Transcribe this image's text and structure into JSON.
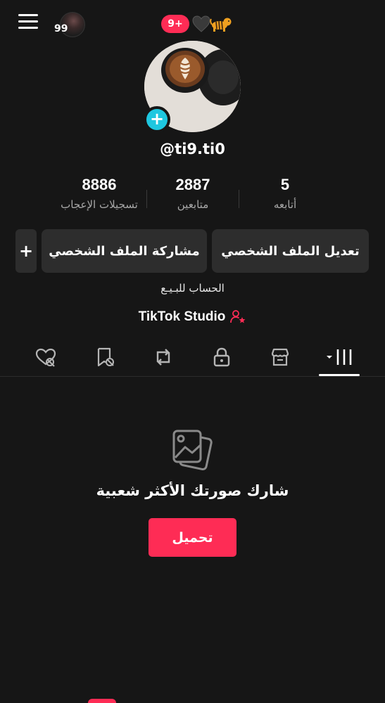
{
  "header": {
    "views_count": "99",
    "notifications_badge": "9+",
    "title_emojis": [
      "black-heart",
      "tiger"
    ]
  },
  "profile": {
    "username": "@ti9.ti0",
    "bio": "الحساب للبـيـع",
    "studio_link": "TikTok Studio"
  },
  "stats": [
    {
      "value": "8886",
      "label": "تسجيلات الإعجاب"
    },
    {
      "value": "2887",
      "label": "متابعين"
    },
    {
      "value": "5",
      "label": "أتابعه"
    }
  ],
  "buttons": {
    "edit_profile": "تعديل الملف الشخصي",
    "share_profile": "مشاركة الملف الشخصي",
    "more": "+"
  },
  "tabs": [
    {
      "icon": "liked-hidden-icon"
    },
    {
      "icon": "favorites-hidden-icon"
    },
    {
      "icon": "repost-icon"
    },
    {
      "icon": "lock-icon"
    },
    {
      "icon": "shop-icon"
    },
    {
      "icon": "grid-dropdown-icon",
      "active": true
    }
  ],
  "empty_state": {
    "title": "شارك صورتك الأكثر شعبية",
    "upload_button": "تحميل"
  },
  "colors": {
    "background": "#161616",
    "accent": "#fe2c55",
    "avatar_add": "#1ec7e0",
    "button_bg": "#2d2d2d",
    "muted_text": "#a7a7a7"
  }
}
